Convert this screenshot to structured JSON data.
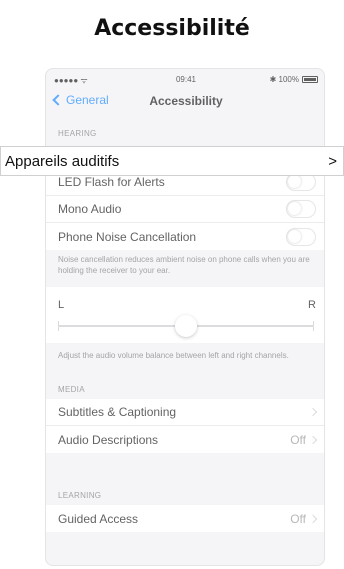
{
  "page": {
    "title": "Accessibilité"
  },
  "status_bar": {
    "signal": "●●●●● ᯤ",
    "time": "09:41",
    "battery": "✱ 100%"
  },
  "nav": {
    "back_label": "General",
    "title": "Accessibility"
  },
  "hearing": {
    "header": "HEARING",
    "items": [
      {
        "label": "LED Flash for Alerts",
        "toggle_on": false
      },
      {
        "label": "Mono Audio",
        "toggle_on": false
      },
      {
        "label": "Phone Noise Cancellation",
        "toggle_on": false
      }
    ],
    "note": "Noise cancellation reduces ambient noise on phone calls when you are holding the receiver to your ear."
  },
  "balance": {
    "left_label": "L",
    "right_label": "R",
    "value": 0.5,
    "note": "Adjust the audio volume balance between left and right channels."
  },
  "media": {
    "header": "MEDIA",
    "items": [
      {
        "label": "Subtitles & Captioning",
        "value": ""
      },
      {
        "label": "Audio Descriptions",
        "value": "Off"
      }
    ]
  },
  "learning": {
    "header": "LEARNING",
    "items": [
      {
        "label": "Guided Access",
        "value": "Off"
      }
    ]
  },
  "overlay": {
    "label": "Appareils auditifs",
    "chevron": ">"
  }
}
